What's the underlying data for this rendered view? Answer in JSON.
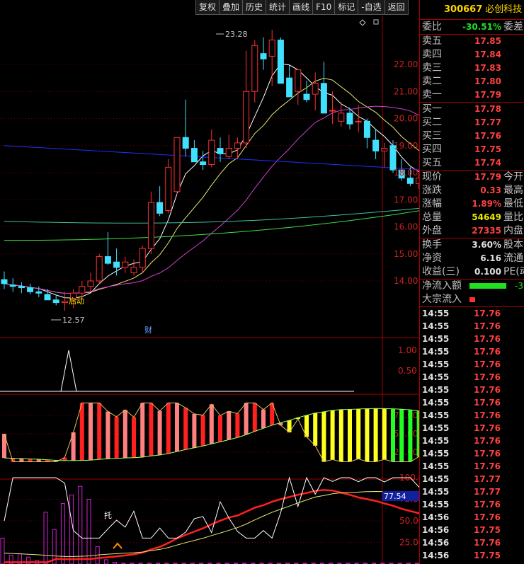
{
  "toolbar": {
    "buttons": [
      "复权",
      "叠加",
      "历史",
      "统计",
      "画线",
      "F10",
      "标记",
      "-自选",
      "返回"
    ]
  },
  "stock": {
    "code": "300667",
    "name": "必创科技"
  },
  "weibi": {
    "label": "委比",
    "value": "-30.51%",
    "label2": "委差"
  },
  "asks": [
    {
      "label": "卖五",
      "price": "17.85"
    },
    {
      "label": "卖四",
      "price": "17.84"
    },
    {
      "label": "卖三",
      "price": "17.83"
    },
    {
      "label": "卖二",
      "price": "17.80"
    },
    {
      "label": "卖一",
      "price": "17.79"
    }
  ],
  "bids": [
    {
      "label": "买一",
      "price": "17.78"
    },
    {
      "label": "买二",
      "price": "17.77"
    },
    {
      "label": "买三",
      "price": "17.76"
    },
    {
      "label": "买四",
      "price": "17.75"
    },
    {
      "label": "买五",
      "price": "17.74"
    }
  ],
  "quote": [
    {
      "label": "现价",
      "value": "17.79",
      "label2": "今开",
      "color": "red"
    },
    {
      "label": "涨跌",
      "value": "0.33",
      "label2": "最高",
      "color": "red"
    },
    {
      "label": "涨幅",
      "value": "1.89%",
      "label2": "最低",
      "color": "red"
    },
    {
      "label": "总量",
      "value": "54649",
      "label2": "量比",
      "color": "yellow"
    },
    {
      "label": "外盘",
      "value": "27335",
      "label2": "内盘",
      "color": "red"
    }
  ],
  "fundamentals": [
    {
      "label": "换手",
      "value": "3.60%",
      "label2": "股本"
    },
    {
      "label": "净资",
      "value": "6.16",
      "label2": "流通"
    },
    {
      "label": "收益(三)",
      "value": "0.100",
      "label2": "PE(动"
    }
  ],
  "flow": {
    "net_label": "净流入额",
    "net_value": "-3",
    "big_label": "大宗流入"
  },
  "ticks": [
    {
      "time": "14:55",
      "price": "17.76"
    },
    {
      "time": "14:55",
      "price": "17.76"
    },
    {
      "time": "14:55",
      "price": "17.76"
    },
    {
      "time": "14:55",
      "price": "17.76"
    },
    {
      "time": "14:55",
      "price": "17.76"
    },
    {
      "time": "14:55",
      "price": "17.76"
    },
    {
      "time": "14:55",
      "price": "17.76"
    },
    {
      "time": "14:55",
      "price": "17.76"
    },
    {
      "time": "14:55",
      "price": "17.76"
    },
    {
      "time": "14:55",
      "price": "17.76"
    },
    {
      "time": "14:55",
      "price": "17.76"
    },
    {
      "time": "14:55",
      "price": "17.76"
    },
    {
      "time": "14:55",
      "price": "17.76"
    },
    {
      "time": "14:55",
      "price": "17.77"
    },
    {
      "time": "14:55",
      "price": "17.77"
    },
    {
      "time": "14:55",
      "price": "17.76"
    },
    {
      "time": "14:56",
      "price": "17.76"
    },
    {
      "time": "14:56",
      "price": "17.75"
    },
    {
      "time": "14:56",
      "price": "17.76"
    },
    {
      "time": "14:56",
      "price": "17.75"
    }
  ],
  "chart": {
    "high_label": "23.28",
    "low_label": "12.57",
    "start_label": "启动",
    "cai_label": "财",
    "tuo_label": "托",
    "indicator_value": "77.54"
  },
  "chart_data": {
    "type": "candlestick",
    "price_axis": [
      "22.00",
      "21.00",
      "20.00",
      "19.00",
      "18.00",
      "17.00",
      "16.00",
      "15.00",
      "14.00"
    ],
    "signal_axis": [
      "1.00",
      "0.50"
    ],
    "osc_axis": [
      "75.00",
      "50.00",
      "25.00"
    ],
    "bottom_axis": [
      "100.0",
      "75.00",
      "50.00",
      "25.00"
    ],
    "candles": [
      [
        14.05,
        14.35,
        13.7,
        13.9
      ],
      [
        13.85,
        14.1,
        13.6,
        13.8
      ],
      [
        13.8,
        13.95,
        13.55,
        13.75
      ],
      [
        13.75,
        13.9,
        13.5,
        13.6
      ],
      [
        13.6,
        13.8,
        13.4,
        13.55
      ],
      [
        13.5,
        13.7,
        13.35,
        13.3
      ],
      [
        13.3,
        13.5,
        13.1,
        13.2
      ],
      [
        13.2,
        13.6,
        12.9,
        13.25
      ],
      [
        13.3,
        13.7,
        13.0,
        13.55
      ],
      [
        13.55,
        14.0,
        13.3,
        13.8
      ],
      [
        13.8,
        14.3,
        13.6,
        14.0
      ],
      [
        14.0,
        15.0,
        13.9,
        14.9
      ],
      [
        14.9,
        15.8,
        14.6,
        14.65
      ],
      [
        14.7,
        15.2,
        14.2,
        14.5
      ],
      [
        14.5,
        14.9,
        14.3,
        14.7
      ],
      [
        14.3,
        14.8,
        14.2,
        14.5
      ],
      [
        14.5,
        15.3,
        14.3,
        15.2
      ],
      [
        15.2,
        17.3,
        15.0,
        16.9
      ],
      [
        16.9,
        17.5,
        16.4,
        16.5
      ],
      [
        16.6,
        18.5,
        16.5,
        18.2
      ],
      [
        17.3,
        19.3,
        17.2,
        19.3
      ],
      [
        19.3,
        20.7,
        18.6,
        18.9
      ],
      [
        18.9,
        19.2,
        18.4,
        18.4
      ],
      [
        18.4,
        18.8,
        18.1,
        18.3
      ],
      [
        18.3,
        19.6,
        18.2,
        19.2
      ],
      [
        18.9,
        19.3,
        18.4,
        18.7
      ],
      [
        18.6,
        19.4,
        18.5,
        18.9
      ],
      [
        18.9,
        19.3,
        18.5,
        19.1
      ],
      [
        19.1,
        22.5,
        18.9,
        21.0
      ],
      [
        21.0,
        22.9,
        20.6,
        22.7
      ],
      [
        22.4,
        23.0,
        21.8,
        22.2
      ],
      [
        22.3,
        23.28,
        21.2,
        22.9
      ],
      [
        22.9,
        23.0,
        21.5,
        21.3
      ],
      [
        21.5,
        22.0,
        20.8,
        20.8
      ],
      [
        21.0,
        21.6,
        20.5,
        21.8
      ],
      [
        20.9,
        21.4,
        20.6,
        20.7
      ],
      [
        20.9,
        21.7,
        20.3,
        21.3
      ],
      [
        21.3,
        22.1,
        20.5,
        20.2
      ],
      [
        20.3,
        21.0,
        19.8,
        20.3
      ],
      [
        19.9,
        20.6,
        19.7,
        20.2
      ],
      [
        20.2,
        20.4,
        19.6,
        19.8
      ],
      [
        19.9,
        20.5,
        19.5,
        19.9
      ],
      [
        19.9,
        20.0,
        18.9,
        19.3
      ],
      [
        19.2,
        19.6,
        18.5,
        18.8
      ],
      [
        18.8,
        19.1,
        18.2,
        18.9
      ],
      [
        19.0,
        19.2,
        18.0,
        18.1
      ],
      [
        18.1,
        18.5,
        17.7,
        17.8
      ],
      [
        17.8,
        18.2,
        17.5,
        17.6
      ],
      [
        17.6,
        18.0,
        17.4,
        17.8
      ],
      [
        17.8,
        18.0,
        17.3,
        17.6
      ],
      [
        17.5,
        17.7,
        17.3,
        17.4
      ],
      [
        17.4,
        17.6,
        17.2,
        17.55
      ],
      [
        17.46,
        17.85,
        17.4,
        17.79
      ]
    ]
  },
  "colors": {
    "up": "#ff3030",
    "down": "#40e0ff",
    "ma5": "#ffffff",
    "ma10": "#e8e870",
    "ma20": "#d040d0",
    "ma60": "#40e040",
    "ma120": "#2030ff",
    "ma250": "#40c0a0"
  }
}
